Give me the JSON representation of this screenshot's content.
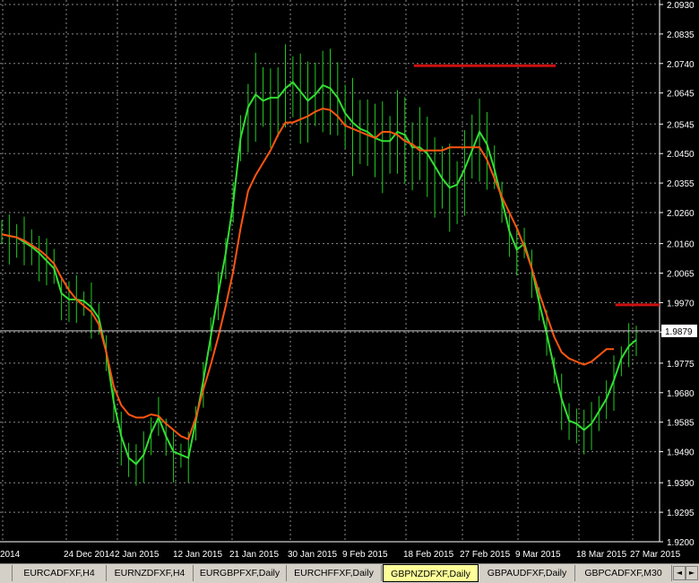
{
  "chart_data": {
    "type": "line",
    "symbol": "GBPNZDFX",
    "timeframe": "Daily",
    "x_labels": [
      "2014",
      "24 Dec 2014",
      "2 Jan 2015",
      "12 Jan 2015",
      "21 Jan 2015",
      "30 Jan 2015",
      "9 Feb 2015",
      "18 Feb 2015",
      "27 Feb 2015",
      "9 Mar 2015",
      "18 Mar 2015",
      "27 Mar 2015"
    ],
    "y_ticks": [
      "2.0930",
      "2.0835",
      "2.0740",
      "2.0645",
      "2.0545",
      "2.0450",
      "2.0355",
      "2.0260",
      "2.0160",
      "2.0065",
      "1.9970",
      "1.9875",
      "1.9775",
      "1.9680",
      "1.9585",
      "1.9490",
      "1.9390",
      "1.9295",
      "1.9200"
    ],
    "ylim": [
      1.92,
      2.093
    ],
    "current_price": "1.9879",
    "current_price_value": 1.9879,
    "series": [
      {
        "color": "#33dd33",
        "values": [
          2.019,
          2.0185,
          2.018,
          2.0165,
          2.015,
          2.013,
          2.0105,
          2.008,
          2.0,
          1.998,
          1.998,
          1.9975,
          1.9955,
          1.992,
          1.981,
          1.965,
          1.954,
          1.947,
          1.945,
          1.948,
          1.955,
          1.96,
          1.954,
          1.949,
          1.948,
          1.947,
          1.959,
          1.972,
          1.986,
          2.0,
          2.013,
          2.029,
          2.05,
          2.06,
          2.064,
          2.062,
          2.063,
          2.063,
          2.066,
          2.068,
          2.065,
          2.062,
          2.064,
          2.067,
          2.066,
          2.063,
          2.058,
          2.055,
          2.053,
          2.052,
          2.05,
          2.049,
          2.049,
          2.052,
          2.051,
          2.047,
          2.047,
          2.045,
          2.041,
          2.037,
          2.034,
          2.035,
          2.04,
          2.046,
          2.052,
          2.048,
          2.04,
          2.03,
          2.02,
          2.014,
          2.016,
          2.008,
          1.997,
          1.987,
          1.976,
          1.966,
          1.959,
          1.958,
          1.956,
          1.958,
          1.962,
          1.966,
          1.972,
          1.979,
          1.983,
          1.985
        ]
      },
      {
        "color": "#ff5511",
        "values": [
          2.019,
          2.0185,
          2.018,
          2.017,
          2.0155,
          2.014,
          2.012,
          2.0095,
          2.005,
          2.001,
          1.998,
          1.996,
          1.994,
          1.99,
          1.981,
          1.97,
          1.964,
          1.961,
          1.96,
          1.96,
          1.961,
          1.9605,
          1.958,
          1.956,
          1.954,
          1.953,
          1.96,
          1.969,
          1.977,
          1.986,
          1.996,
          2.007,
          2.021,
          2.033,
          2.038,
          2.042,
          2.046,
          2.051,
          2.055,
          2.055,
          2.056,
          2.057,
          2.0585,
          2.0595,
          2.059,
          2.057,
          2.054,
          2.053,
          2.052,
          2.051,
          2.05,
          2.052,
          2.052,
          2.051,
          2.049,
          2.048,
          2.046,
          2.046,
          2.046,
          2.046,
          2.047,
          2.047,
          2.047,
          2.047,
          2.047,
          2.043,
          2.037,
          2.031,
          2.026,
          2.021,
          2.015,
          2.008,
          2.0,
          1.993,
          1.986,
          1.981,
          1.979,
          1.978,
          1.977,
          1.978,
          1.98,
          1.982,
          1.982
        ]
      }
    ],
    "resistance_lines": [
      {
        "color": "#cc1111",
        "value": 2.0733,
        "from_index": 54,
        "to_index": 73
      },
      {
        "color": "#cc1111",
        "value": 1.9963,
        "from_index": 81,
        "to_index": 85
      }
    ],
    "grid": true
  },
  "tabs": [
    {
      "label": "",
      "active": false
    },
    {
      "label": "EURCADFXF,H4",
      "active": false
    },
    {
      "label": "EURNZDFXF,H4",
      "active": false
    },
    {
      "label": "EURGBPFXF,Daily",
      "active": false
    },
    {
      "label": "EURCHFFXF,Daily",
      "active": false
    },
    {
      "label": "GBPNZDFXF,Daily",
      "active": true
    },
    {
      "label": "GBPAUDFXF,Daily",
      "active": false
    },
    {
      "label": "GBPCADFXF,M30",
      "active": false
    }
  ],
  "scroll_left": "◄",
  "scroll_right": "►",
  "colors": {
    "background": "#000000",
    "grid": "#8a8a8a",
    "bars": "#22cc22",
    "fast_ma": "#33dd33",
    "slow_ma": "#ff5511",
    "level": "#cc1111"
  }
}
